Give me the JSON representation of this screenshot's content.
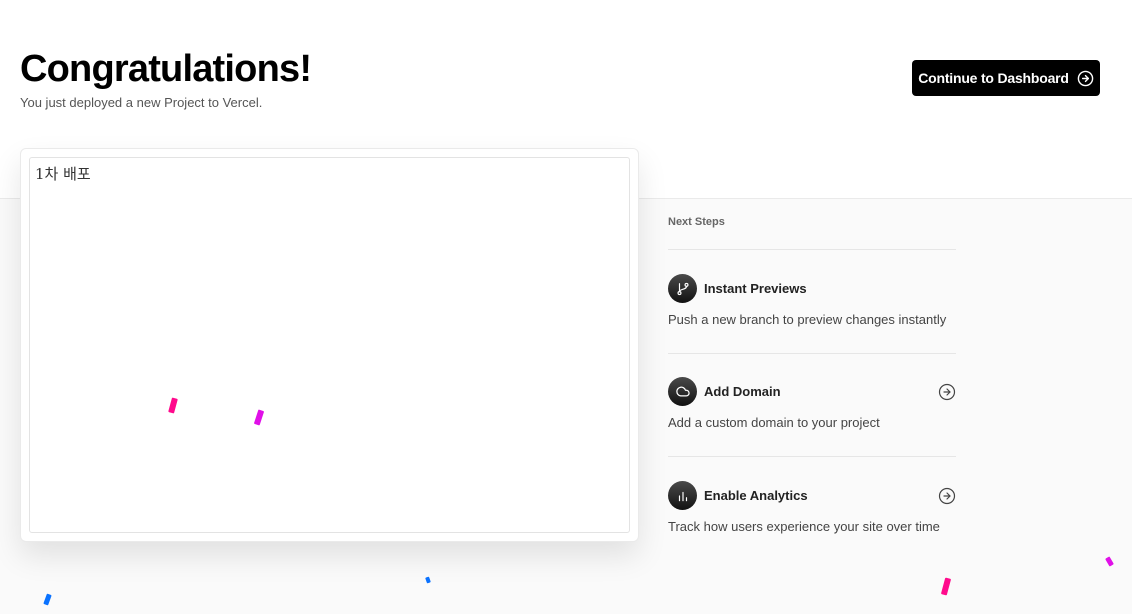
{
  "header": {
    "title": "Congratulations!",
    "subtitle": "You just deployed a new Project to Vercel.",
    "cta_label": "Continue to Dashboard"
  },
  "preview": {
    "text": "1차 배포"
  },
  "next_steps": {
    "label": "Next Steps",
    "items": [
      {
        "title": "Instant Previews",
        "description": "Push a new branch to preview changes instantly",
        "icon": "git-branch-icon"
      },
      {
        "title": "Add Domain",
        "description": "Add a custom domain to your project",
        "icon": "cloud-icon"
      },
      {
        "title": "Enable Analytics",
        "description": "Track how users experience your site over time",
        "icon": "bar-chart-icon"
      }
    ]
  },
  "colors": {
    "primary": "#000000",
    "confetti_pink": "#ff0a8c",
    "confetti_magenta": "#e010e8",
    "confetti_blue": "#0a72ff"
  }
}
